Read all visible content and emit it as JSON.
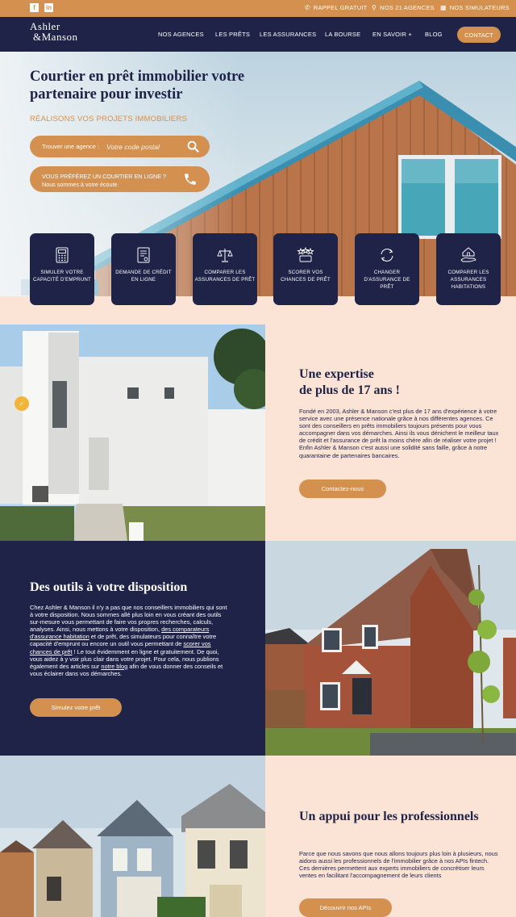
{
  "topbar": {
    "social": [
      {
        "icon": "facebook-icon",
        "glyph": "f"
      },
      {
        "icon": "linkedin-icon",
        "glyph": "in"
      }
    ],
    "callback_label": "RAPPEL GRATUIT",
    "agencies_label": "NOS 21 AGENCES",
    "simulators_label": "NOS SIMULATEURS"
  },
  "nav": {
    "logo_line1": "Ashler",
    "logo_line2": "&Manson",
    "items": [
      "NOS AGENCES",
      "LES PRÊTS",
      "LES ASSURANCES",
      "LA BOURSE",
      "EN SAVOIR +",
      "BLOG"
    ],
    "contact_label": "CONTACT"
  },
  "hero": {
    "title": "Courtier en prêt immobilier votre partenaire pour investir",
    "subtitle": "RÉALISONS VOS PROJETS IMMOBILIERS",
    "search_label": "Trouver une agence :",
    "search_placeholder": "Votre code postal",
    "call_line1": "VOUS PRÉFÉREZ UN COURTIER EN LIGNE ?",
    "call_line2": "Nous sommes à votre écoute."
  },
  "tools": [
    {
      "icon": "calculator-icon",
      "label": "SIMULER VOTRE CAPACITÉ D'EMPRUNT"
    },
    {
      "icon": "document-icon",
      "label": "DEMANDE DE CRÉDIT EN LIGNE"
    },
    {
      "icon": "balance-scale-icon",
      "label": "COMPARER LES ASSURANCES DE PRÊT"
    },
    {
      "icon": "stars-icon",
      "label": "SCORER VOS CHANCES DE PRÊT"
    },
    {
      "icon": "refresh-icon",
      "label": "CHANGER D'ASSURANCE DE PRÊT"
    },
    {
      "icon": "house-hand-icon",
      "label": "COMPARER LES ASSURANCES HABITATIONS"
    }
  ],
  "expertise": {
    "title_line1": "Une expertise",
    "title_line2": "de plus de 17 ans !",
    "body": "Fondé en 2003, Ashler & Manson c'est plus de 17 ans d'expérience à votre service avec une présence nationale grâce à nos différentes agences. Ce sont des conseillers en prêts immobiliers toujours présents pour vous accompagner dans vos démarches. Ainsi ils vous dénichent le meilleur taux de crédit et l'assurance de prêt la moins chère afin de réaliser votre projet ! Enfin Ashler & Manson c'est aussi une solidité sans faille, grâce à notre quarantaine de partenaires bancaires.",
    "button": "Contactez-nous"
  },
  "tools_section": {
    "title": "Des outils à votre disposition",
    "body_1": "Chez Ashler & Manson il n'y a pas que nos conseillers immobiliers qui sont à votre disposition. Nous sommes allé plus loin en vous créant des outils sur-mesure vous permettant de faire vos propres recherches, calculs, analyses. Ainsi, nous mettons à votre disposition,",
    "link_1": "des comparateurs d'assurance habitation",
    "body_2": " et de prêt, des simulateurs pour connaître votre capacité d'emprunt ou encore un outil vous permettant de ",
    "link_2": "scorer vos chances de prêt",
    "body_3": " ! Le tout évidemment en ligne et gratuitement. De quoi, vous aidez à y voir plus clair dans votre projet. Pour cela, nous publions également des articles sur ",
    "link_3": "notre blog",
    "body_4": " afin de vous donner des conseils et vous éclairer dans vos démarches.",
    "button": "Simulez votre prêt"
  },
  "pro_section": {
    "title": "Un appui pour les professionnels",
    "body": "Parce que nous savons que nous allons toujours plus loin à plusieurs, nous aidons aussi les professionnels de l'immobilier grâce à nos APIs fintech. Ces dernières permettent aux experts immobiliers de concrétiser leurs ventes en facilitant l'accompagnement de leurs clients",
    "button": "Découvrir nos APIs"
  },
  "colors": {
    "navy": "#1e2347",
    "orange": "#d4904f",
    "peach": "#fbe3d6"
  }
}
